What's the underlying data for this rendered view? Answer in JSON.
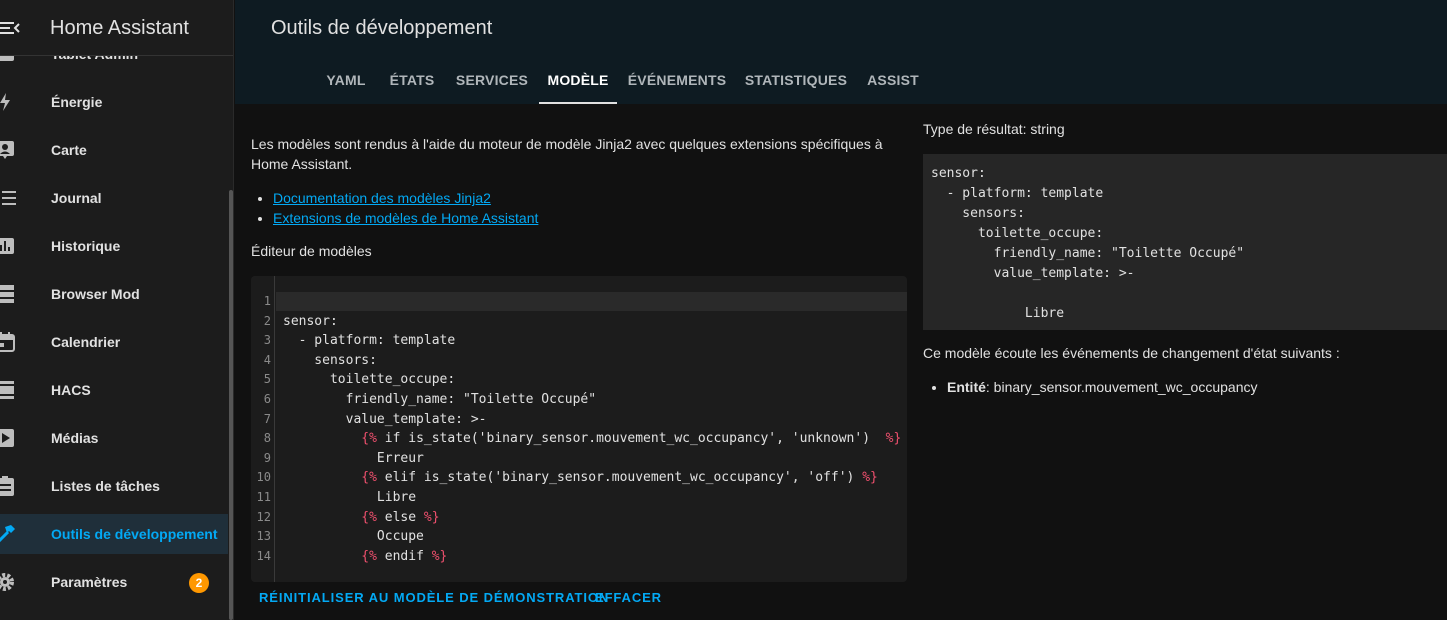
{
  "app": {
    "title": "Home Assistant"
  },
  "sidebar": {
    "items": [
      {
        "label": "Tablet Admin",
        "icon": "tablet-icon"
      },
      {
        "label": "Énergie",
        "icon": "lightning-icon"
      },
      {
        "label": "Carte",
        "icon": "map-account-icon"
      },
      {
        "label": "Journal",
        "icon": "list-icon"
      },
      {
        "label": "Historique",
        "icon": "chart-bar-icon"
      },
      {
        "label": "Browser Mod",
        "icon": "server-icon"
      },
      {
        "label": "Calendrier",
        "icon": "calendar-icon"
      },
      {
        "label": "HACS",
        "icon": "hacs-icon"
      },
      {
        "label": "Médias",
        "icon": "play-box-icon"
      },
      {
        "label": "Listes de tâches",
        "icon": "clipboard-list-icon"
      },
      {
        "label": "Outils de développement",
        "icon": "hammer-icon",
        "active": true
      },
      {
        "label": "Paramètres",
        "icon": "cog-icon",
        "badge": "2"
      }
    ]
  },
  "header": {
    "title": "Outils de développement",
    "tabs": [
      {
        "label": "YAML"
      },
      {
        "label": "ÉTATS"
      },
      {
        "label": "SERVICES"
      },
      {
        "label": "MODÈLE",
        "active": true
      },
      {
        "label": "ÉVÉNEMENTS"
      },
      {
        "label": "STATISTIQUES"
      },
      {
        "label": "ASSIST"
      }
    ]
  },
  "main": {
    "intro": "Les modèles sont rendus à l'aide du moteur de modèle Jinja2 avec quelques extensions spécifiques à Home Assistant.",
    "links": [
      "Documentation des modèles Jinja2",
      "Extensions de modèles de Home Assistant"
    ],
    "editor_label": "Éditeur de modèles",
    "code_lines": [
      "",
      "sensor:",
      "  - platform: template",
      "    sensors:",
      "      toilette_occupe:",
      "        friendly_name: \"Toilette Occupé\"",
      "        value_template: >-",
      "          {% if is_state('binary_sensor.mouvement_wc_occupancy', 'unknown')  %}",
      "            Erreur",
      "          {% elif is_state('binary_sensor.mouvement_wc_occupancy', 'off') %}",
      "            Libre",
      "          {% else %}",
      "            Occupe",
      "          {% endif %}"
    ],
    "buttons": {
      "reset": "RÉINITIALISER AU MODÈLE DE DÉMONSTRATION",
      "clear": "EFFACER"
    }
  },
  "result": {
    "type_label": "Type de résultat: string",
    "output": "sensor:\n  - platform: template\n    sensors:\n      toilette_occupe:\n        friendly_name: \"Toilette Occupé\"\n        value_template: >-\n\n            Libre",
    "listen_text": "Ce modèle écoute les événements de changement d'état suivants :",
    "entity_label": "Entité",
    "entity_value": ": binary_sensor.mouvement_wc_occupancy"
  },
  "colors": {
    "accent": "#03a9f4",
    "jinja": "#f0506e",
    "badge": "#ff9800"
  }
}
